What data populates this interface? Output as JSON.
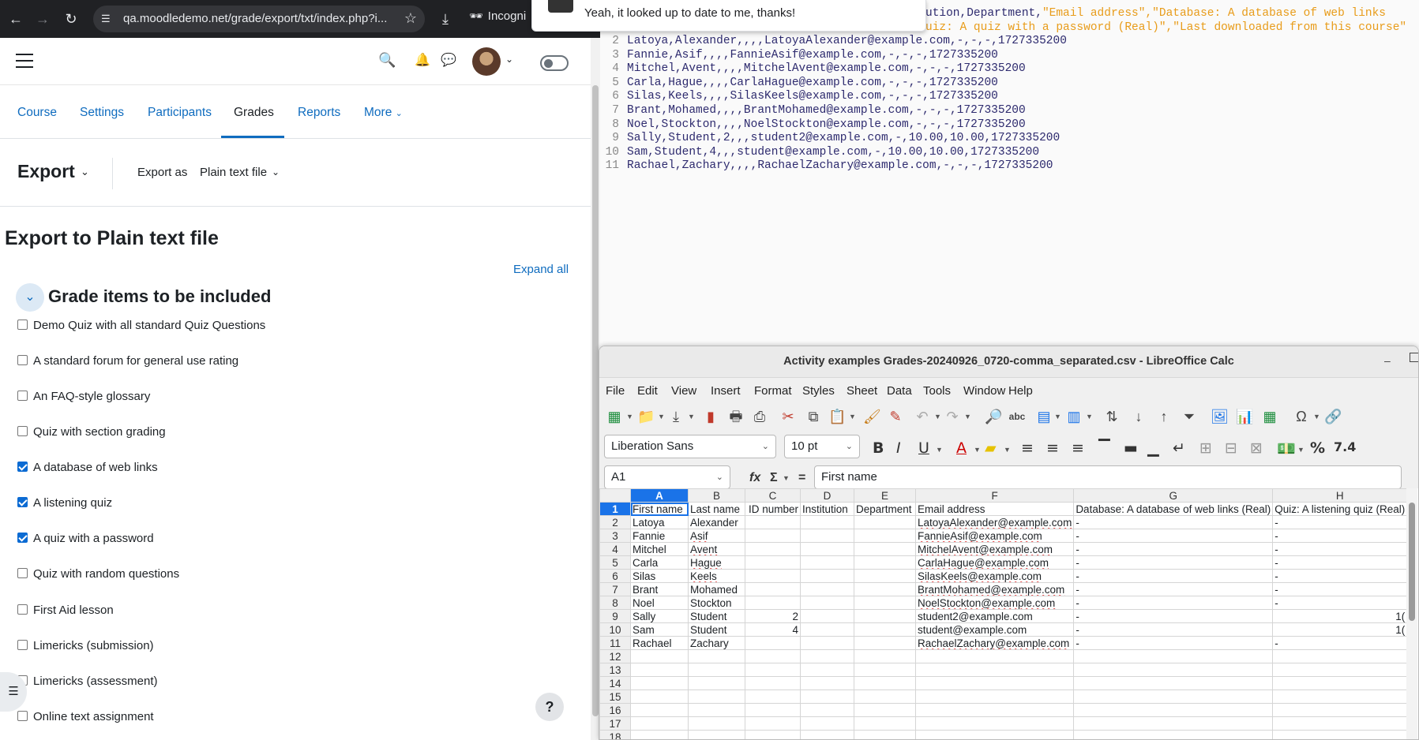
{
  "browser": {
    "url": "qa.moodledemo.net/grade/export/txt/index.php?i...",
    "incognito_label": "Incogni"
  },
  "notification": {
    "text": "Yeah, it looked up to date to me, thanks!"
  },
  "moodle": {
    "nav_tabs": [
      {
        "label": "Course"
      },
      {
        "label": "Settings"
      },
      {
        "label": "Participants"
      },
      {
        "label": "Grades"
      },
      {
        "label": "Reports"
      },
      {
        "label": "More"
      }
    ],
    "export_menu_label": "Export",
    "export_as_label": "Export as",
    "export_as_value": "Plain text file",
    "page_heading": "Export to Plain text file",
    "expand_all": "Expand all",
    "section_title": "Grade items to be included",
    "grade_items": [
      {
        "label": "Demo Quiz with all standard Quiz Questions",
        "checked": false
      },
      {
        "label": "A standard forum for general use rating",
        "checked": false
      },
      {
        "label": "An FAQ-style glossary",
        "checked": false
      },
      {
        "label": "Quiz with section grading",
        "checked": false
      },
      {
        "label": "A database of web links",
        "checked": true
      },
      {
        "label": "A listening quiz",
        "checked": true
      },
      {
        "label": "A quiz with a password",
        "checked": true
      },
      {
        "label": "Quiz with random questions",
        "checked": false
      },
      {
        "label": "First Aid lesson",
        "checked": false
      },
      {
        "label": "Limericks (submission)",
        "checked": false
      },
      {
        "label": "Limericks (assessment)",
        "checked": false
      },
      {
        "label": "Online text assignment",
        "checked": false
      }
    ],
    "help_label": "?"
  },
  "editor": {
    "line1_plain": "ution,Department,",
    "line1_str1": "\"Email address\",\"Database: A database of web links",
    "line1b_str": "uiz: A quiz with a password (Real)\",\"Last downloaded from this course\"",
    "lines": [
      {
        "n": "2",
        "text": "Latoya,Alexander,,,,LatoyaAlexander@example.com,-,-,-,1727335200"
      },
      {
        "n": "3",
        "text": "Fannie,Asif,,,,FannieAsif@example.com,-,-,-,1727335200"
      },
      {
        "n": "4",
        "text": "Mitchel,Avent,,,,MitchelAvent@example.com,-,-,-,1727335200"
      },
      {
        "n": "5",
        "text": "Carla,Hague,,,,CarlaHague@example.com,-,-,-,1727335200"
      },
      {
        "n": "6",
        "text": "Silas,Keels,,,,SilasKeels@example.com,-,-,-,1727335200"
      },
      {
        "n": "7",
        "text": "Brant,Mohamed,,,,BrantMohamed@example.com,-,-,-,1727335200"
      },
      {
        "n": "8",
        "text": "Noel,Stockton,,,,NoelStockton@example.com,-,-,-,1727335200"
      },
      {
        "n": "9",
        "text": "Sally,Student,2,,,student2@example.com,-,10.00,10.00,1727335200"
      },
      {
        "n": "10",
        "text": "Sam,Student,4,,,student@example.com,-,10.00,10.00,1727335200"
      },
      {
        "n": "11",
        "text": "Rachael,Zachary,,,,RachaelZachary@example.com,-,-,-,1727335200"
      }
    ]
  },
  "calc": {
    "title": "Activity examples Grades-20240926_0720-comma_separated.csv - LibreOffice Calc",
    "menu": [
      "File",
      "Edit",
      "View",
      "Insert",
      "Format",
      "Styles",
      "Sheet",
      "Data",
      "Tools",
      "Window",
      "Help"
    ],
    "font_name": "Liberation Sans",
    "font_size": "10 pt",
    "cell_ref": "A1",
    "formula_value": "First name",
    "columns": [
      "A",
      "B",
      "C",
      "D",
      "E",
      "F",
      "G",
      "H"
    ],
    "rows": [
      {
        "n": "1",
        "cells": [
          "First name",
          "Last name",
          "ID number",
          "Institution",
          "Department",
          "Email address",
          "Database: A database of web links (Real)",
          "Quiz: A listening quiz (Real)"
        ]
      },
      {
        "n": "2",
        "cells": [
          "Latoya",
          "Alexander",
          "",
          "",
          "",
          "LatoyaAlexander@example.com",
          "-",
          "-"
        ]
      },
      {
        "n": "3",
        "cells": [
          "Fannie",
          "Asif",
          "",
          "",
          "",
          "FannieAsif@example.com",
          "-",
          "-"
        ]
      },
      {
        "n": "4",
        "cells": [
          "Mitchel",
          "Avent",
          "",
          "",
          "",
          "MitchelAvent@example.com",
          "-",
          "-"
        ]
      },
      {
        "n": "5",
        "cells": [
          "Carla",
          "Hague",
          "",
          "",
          "",
          "CarlaHague@example.com",
          "-",
          "-"
        ]
      },
      {
        "n": "6",
        "cells": [
          "Silas",
          "Keels",
          "",
          "",
          "",
          "SilasKeels@example.com",
          "-",
          "-"
        ]
      },
      {
        "n": "7",
        "cells": [
          "Brant",
          "Mohamed",
          "",
          "",
          "",
          "BrantMohamed@example.com",
          "-",
          "-"
        ]
      },
      {
        "n": "8",
        "cells": [
          "Noel",
          "Stockton",
          "",
          "",
          "",
          "NoelStockton@example.com",
          "-",
          "-"
        ]
      },
      {
        "n": "9",
        "cells": [
          "Sally",
          "Student",
          "2",
          "",
          "",
          "student2@example.com",
          "-",
          "1("
        ]
      },
      {
        "n": "10",
        "cells": [
          "Sam",
          "Student",
          "4",
          "",
          "",
          "student@example.com",
          "-",
          "1("
        ]
      },
      {
        "n": "11",
        "cells": [
          "Rachael",
          "Zachary",
          "",
          "",
          "",
          "RachaelZachary@example.com",
          "-",
          "-"
        ]
      },
      {
        "n": "12",
        "cells": [
          "",
          "",
          "",
          "",
          "",
          "",
          "",
          ""
        ]
      },
      {
        "n": "13",
        "cells": [
          "",
          "",
          "",
          "",
          "",
          "",
          "",
          ""
        ]
      },
      {
        "n": "14",
        "cells": [
          "",
          "",
          "",
          "",
          "",
          "",
          "",
          ""
        ]
      },
      {
        "n": "15",
        "cells": [
          "",
          "",
          "",
          "",
          "",
          "",
          "",
          ""
        ]
      },
      {
        "n": "16",
        "cells": [
          "",
          "",
          "",
          "",
          "",
          "",
          "",
          ""
        ]
      },
      {
        "n": "17",
        "cells": [
          "",
          "",
          "",
          "",
          "",
          "",
          "",
          ""
        ]
      },
      {
        "n": "18",
        "cells": [
          "",
          "",
          "",
          "",
          "",
          "",
          "",
          ""
        ]
      }
    ]
  }
}
